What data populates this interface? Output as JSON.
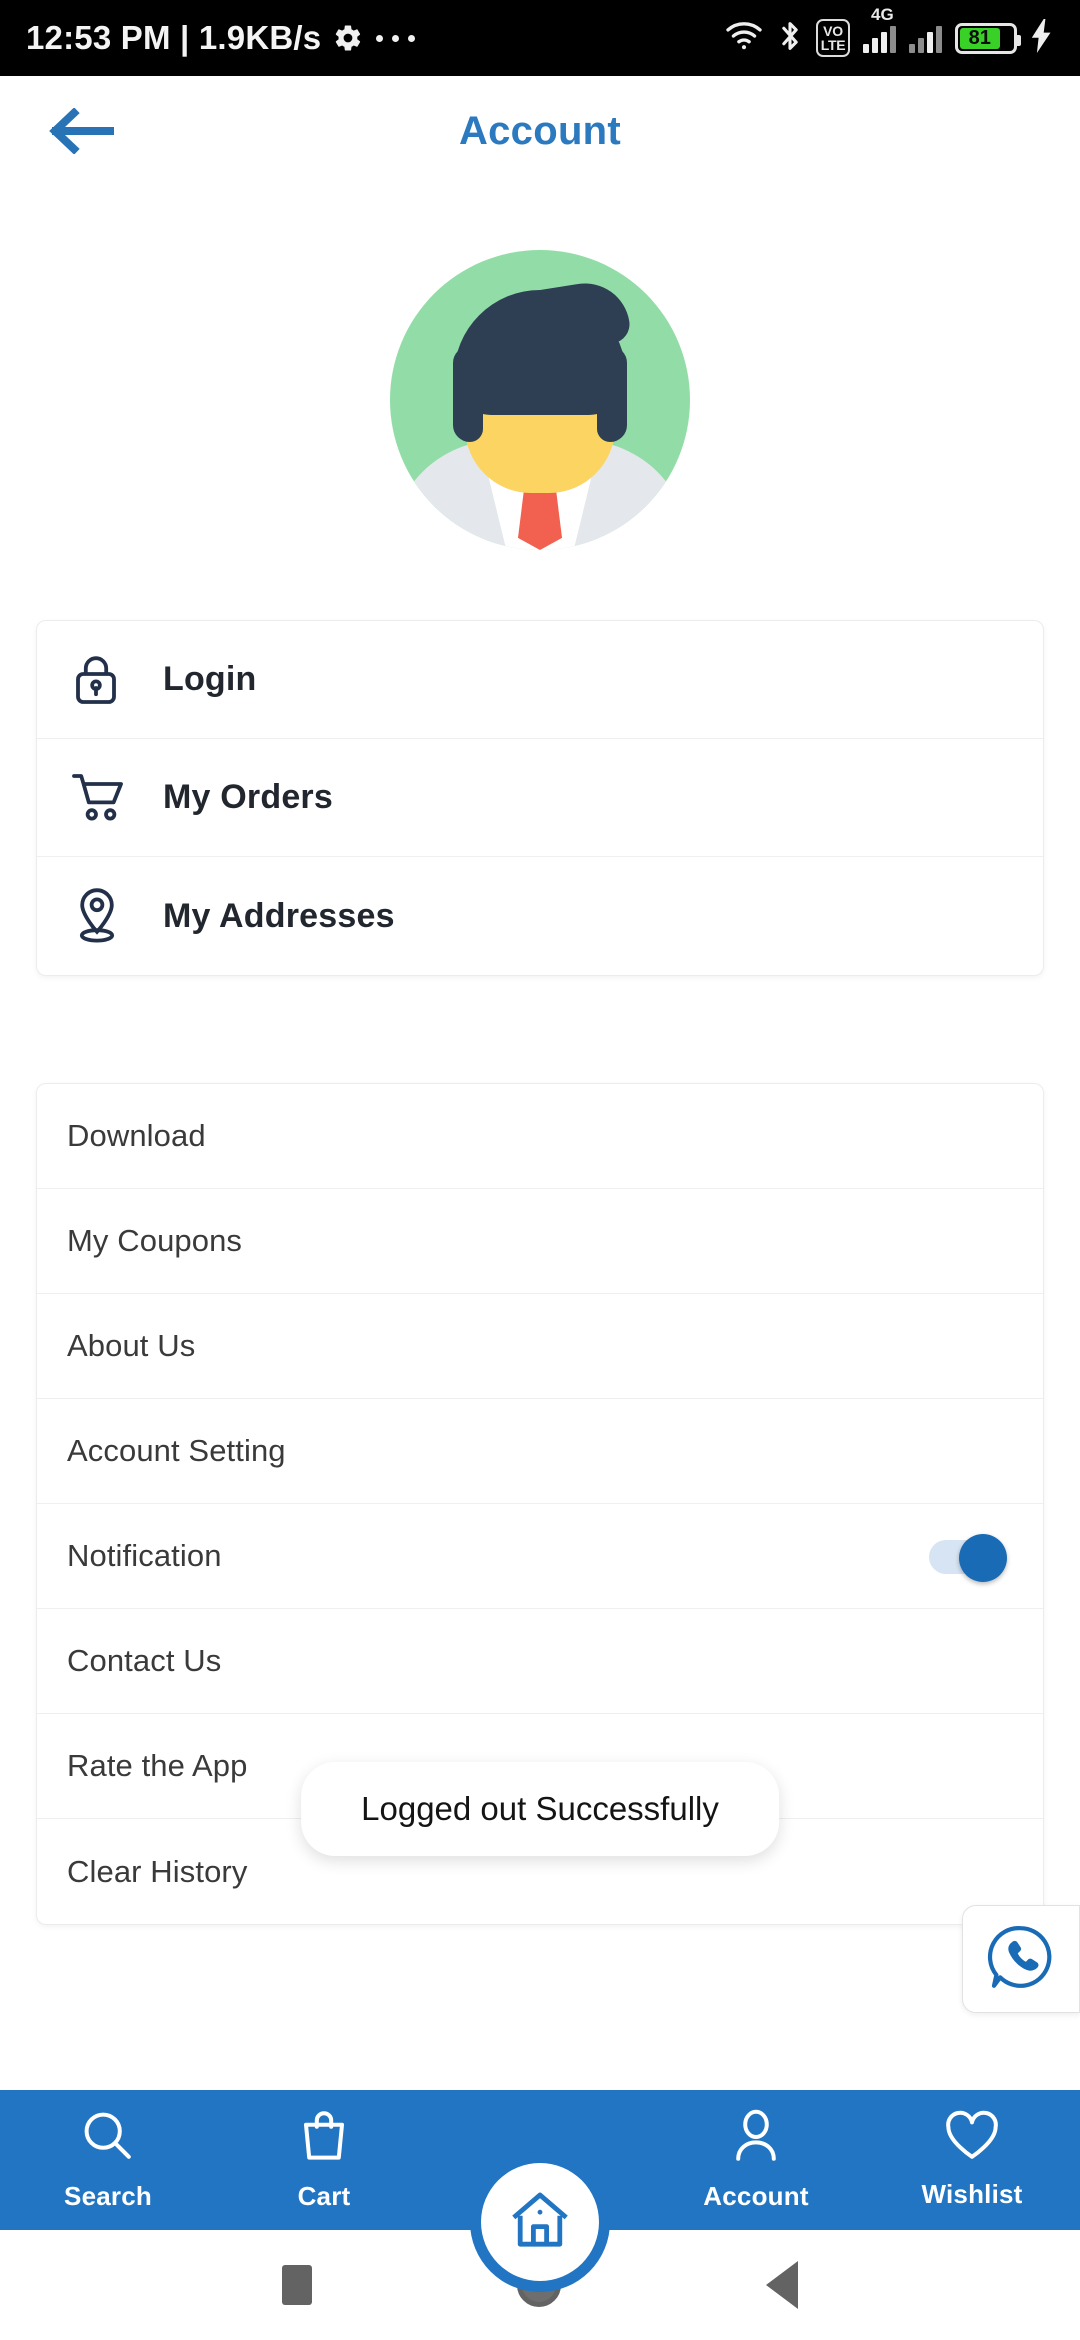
{
  "status_bar": {
    "clock": "12:53 PM | 1.9KB/s",
    "gear_icon": "gear-icon",
    "overflow_icon": "more-dots-icon",
    "wifi_icon": "wifi-icon",
    "bluetooth_icon": "bluetooth-icon",
    "volte_top": "VO",
    "volte_bottom": "LTE",
    "network_type": "4G",
    "battery_level": "81",
    "charging_icon": "charging-bolt-icon",
    "battery_color": "#39d028"
  },
  "header": {
    "back_icon": "arrow-left-icon",
    "title": "Account",
    "title_color": "#2b7ac0"
  },
  "avatar": {
    "name": "user-avatar",
    "bg_color": "#92dda7",
    "hair_color": "#2e3f54",
    "skin_color": "#fcd462",
    "tie_color": "#f2604f",
    "suit_color": "#e4e8ec"
  },
  "primary_menu": {
    "items": [
      {
        "label": "Login",
        "icon": "lock-icon"
      },
      {
        "label": "My Orders",
        "icon": "shopping-cart-icon"
      },
      {
        "label": "My Addresses",
        "icon": "location-pin-icon"
      }
    ]
  },
  "secondary_menu": {
    "items": [
      {
        "label": "Download"
      },
      {
        "label": "My Coupons"
      },
      {
        "label": "About Us"
      },
      {
        "label": "Account Setting"
      },
      {
        "label": "Notification",
        "toggle": "on"
      },
      {
        "label": "Contact Us"
      },
      {
        "label": "Rate the App"
      },
      {
        "label": "Clear History"
      }
    ]
  },
  "toast": {
    "message": "Logged out Successfully"
  },
  "floating_action": {
    "icon": "call-bubble-icon",
    "color": "#1a6bb5"
  },
  "bottom_nav": {
    "bg_color": "#2175c2",
    "items": [
      {
        "label": "Search",
        "icon": "search-icon"
      },
      {
        "label": "Cart",
        "icon": "shopping-bag-icon"
      },
      {
        "label": "Home",
        "icon": "home-icon"
      },
      {
        "label": "Account",
        "icon": "person-icon"
      },
      {
        "label": "Wishlist",
        "icon": "heart-icon"
      }
    ]
  },
  "android_nav": {
    "recents": "recents-square-icon",
    "home": "home-circle-icon",
    "back": "back-triangle-icon"
  }
}
